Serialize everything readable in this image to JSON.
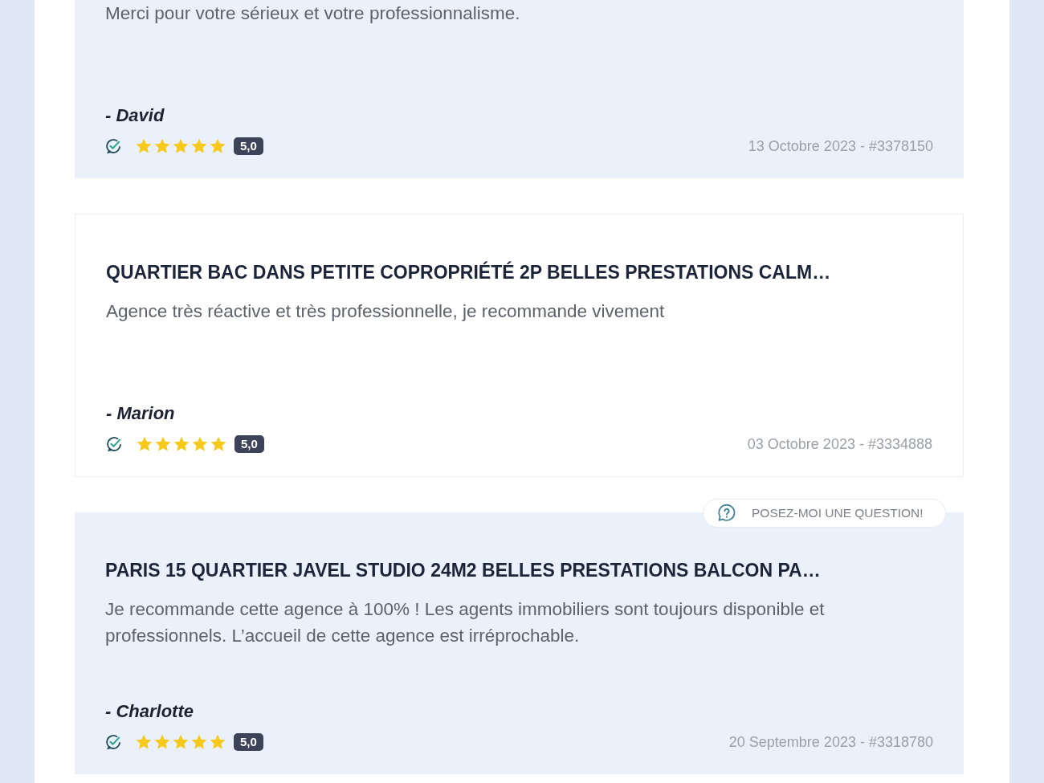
{
  "reviews": [
    {
      "body": "Merci pour votre sérieux et votre professionnalisme.",
      "author": "- David",
      "verified": true,
      "stars": 5,
      "rating": "5,0",
      "meta": "13 Octobre 2023 - #3378150"
    },
    {
      "title": "QUARTIER BAC DANS PETITE COPROPRIÉTÉ 2P BELLES PRESTATIONS CALM…",
      "body": "Agence très réactive et très professionnelle, je recommande vivement",
      "author": "- Marion",
      "verified": true,
      "stars": 5,
      "rating": "5,0",
      "meta": "03 Octobre 2023 - #3334888"
    },
    {
      "title": "PARIS 15 QUARTIER JAVEL STUDIO 24M2 BELLES PRESTATIONS BALCON PA…",
      "body": "Je recommande cette agence à 100% ! Les agents immobiliers sont toujours disponible et professionnels. L’accueil de cette agence est irréprochable.",
      "author": "- Charlotte",
      "verified": true,
      "stars": 5,
      "rating": "5,0",
      "meta": "20 Septembre 2023 - #3318780"
    }
  ],
  "question_button": {
    "label": "POSEZ-MOI UNE QUESTION!"
  }
}
